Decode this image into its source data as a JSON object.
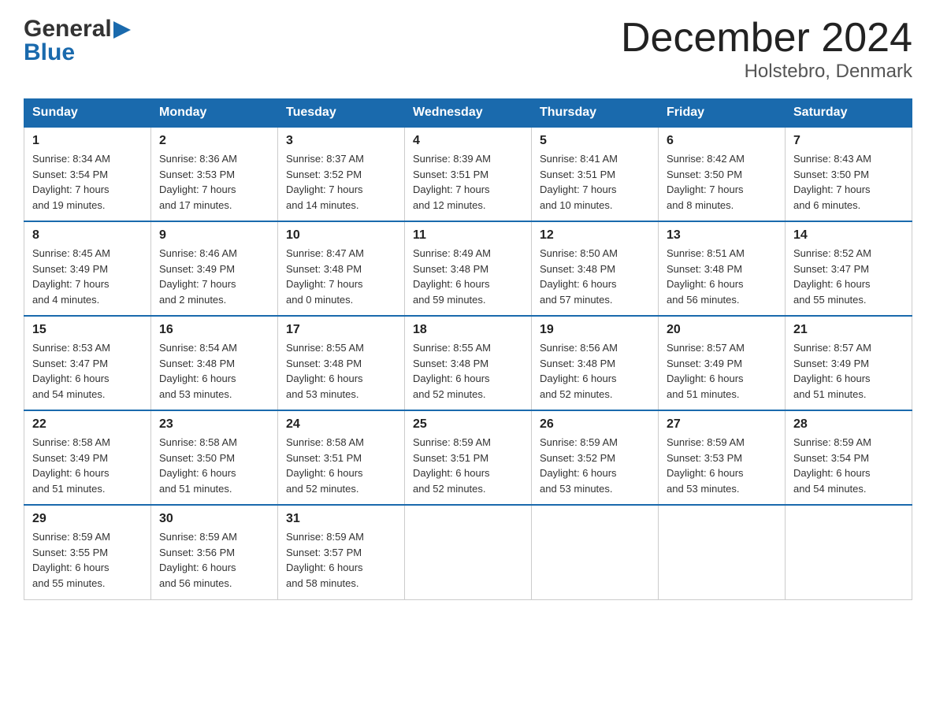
{
  "logo": {
    "general": "General",
    "blue": "Blue"
  },
  "title": "December 2024",
  "subtitle": "Holstebro, Denmark",
  "days_header": [
    "Sunday",
    "Monday",
    "Tuesday",
    "Wednesday",
    "Thursday",
    "Friday",
    "Saturday"
  ],
  "weeks": [
    [
      {
        "num": "1",
        "info": "Sunrise: 8:34 AM\nSunset: 3:54 PM\nDaylight: 7 hours\nand 19 minutes."
      },
      {
        "num": "2",
        "info": "Sunrise: 8:36 AM\nSunset: 3:53 PM\nDaylight: 7 hours\nand 17 minutes."
      },
      {
        "num": "3",
        "info": "Sunrise: 8:37 AM\nSunset: 3:52 PM\nDaylight: 7 hours\nand 14 minutes."
      },
      {
        "num": "4",
        "info": "Sunrise: 8:39 AM\nSunset: 3:51 PM\nDaylight: 7 hours\nand 12 minutes."
      },
      {
        "num": "5",
        "info": "Sunrise: 8:41 AM\nSunset: 3:51 PM\nDaylight: 7 hours\nand 10 minutes."
      },
      {
        "num": "6",
        "info": "Sunrise: 8:42 AM\nSunset: 3:50 PM\nDaylight: 7 hours\nand 8 minutes."
      },
      {
        "num": "7",
        "info": "Sunrise: 8:43 AM\nSunset: 3:50 PM\nDaylight: 7 hours\nand 6 minutes."
      }
    ],
    [
      {
        "num": "8",
        "info": "Sunrise: 8:45 AM\nSunset: 3:49 PM\nDaylight: 7 hours\nand 4 minutes."
      },
      {
        "num": "9",
        "info": "Sunrise: 8:46 AM\nSunset: 3:49 PM\nDaylight: 7 hours\nand 2 minutes."
      },
      {
        "num": "10",
        "info": "Sunrise: 8:47 AM\nSunset: 3:48 PM\nDaylight: 7 hours\nand 0 minutes."
      },
      {
        "num": "11",
        "info": "Sunrise: 8:49 AM\nSunset: 3:48 PM\nDaylight: 6 hours\nand 59 minutes."
      },
      {
        "num": "12",
        "info": "Sunrise: 8:50 AM\nSunset: 3:48 PM\nDaylight: 6 hours\nand 57 minutes."
      },
      {
        "num": "13",
        "info": "Sunrise: 8:51 AM\nSunset: 3:48 PM\nDaylight: 6 hours\nand 56 minutes."
      },
      {
        "num": "14",
        "info": "Sunrise: 8:52 AM\nSunset: 3:47 PM\nDaylight: 6 hours\nand 55 minutes."
      }
    ],
    [
      {
        "num": "15",
        "info": "Sunrise: 8:53 AM\nSunset: 3:47 PM\nDaylight: 6 hours\nand 54 minutes."
      },
      {
        "num": "16",
        "info": "Sunrise: 8:54 AM\nSunset: 3:48 PM\nDaylight: 6 hours\nand 53 minutes."
      },
      {
        "num": "17",
        "info": "Sunrise: 8:55 AM\nSunset: 3:48 PM\nDaylight: 6 hours\nand 53 minutes."
      },
      {
        "num": "18",
        "info": "Sunrise: 8:55 AM\nSunset: 3:48 PM\nDaylight: 6 hours\nand 52 minutes."
      },
      {
        "num": "19",
        "info": "Sunrise: 8:56 AM\nSunset: 3:48 PM\nDaylight: 6 hours\nand 52 minutes."
      },
      {
        "num": "20",
        "info": "Sunrise: 8:57 AM\nSunset: 3:49 PM\nDaylight: 6 hours\nand 51 minutes."
      },
      {
        "num": "21",
        "info": "Sunrise: 8:57 AM\nSunset: 3:49 PM\nDaylight: 6 hours\nand 51 minutes."
      }
    ],
    [
      {
        "num": "22",
        "info": "Sunrise: 8:58 AM\nSunset: 3:49 PM\nDaylight: 6 hours\nand 51 minutes."
      },
      {
        "num": "23",
        "info": "Sunrise: 8:58 AM\nSunset: 3:50 PM\nDaylight: 6 hours\nand 51 minutes."
      },
      {
        "num": "24",
        "info": "Sunrise: 8:58 AM\nSunset: 3:51 PM\nDaylight: 6 hours\nand 52 minutes."
      },
      {
        "num": "25",
        "info": "Sunrise: 8:59 AM\nSunset: 3:51 PM\nDaylight: 6 hours\nand 52 minutes."
      },
      {
        "num": "26",
        "info": "Sunrise: 8:59 AM\nSunset: 3:52 PM\nDaylight: 6 hours\nand 53 minutes."
      },
      {
        "num": "27",
        "info": "Sunrise: 8:59 AM\nSunset: 3:53 PM\nDaylight: 6 hours\nand 53 minutes."
      },
      {
        "num": "28",
        "info": "Sunrise: 8:59 AM\nSunset: 3:54 PM\nDaylight: 6 hours\nand 54 minutes."
      }
    ],
    [
      {
        "num": "29",
        "info": "Sunrise: 8:59 AM\nSunset: 3:55 PM\nDaylight: 6 hours\nand 55 minutes."
      },
      {
        "num": "30",
        "info": "Sunrise: 8:59 AM\nSunset: 3:56 PM\nDaylight: 6 hours\nand 56 minutes."
      },
      {
        "num": "31",
        "info": "Sunrise: 8:59 AM\nSunset: 3:57 PM\nDaylight: 6 hours\nand 58 minutes."
      },
      null,
      null,
      null,
      null
    ]
  ]
}
